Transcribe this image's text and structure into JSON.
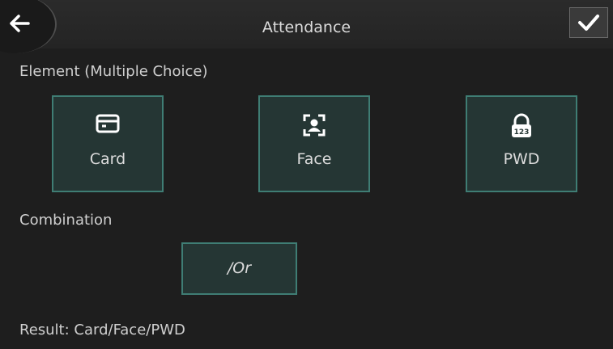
{
  "header": {
    "title": "Attendance",
    "back_icon": "arrow-left-icon",
    "confirm_icon": "checkmark-icon"
  },
  "element_section": {
    "label": "Element (Multiple Choice)",
    "options": [
      {
        "label": "Card",
        "icon": "card-icon",
        "selected": true
      },
      {
        "label": "Face",
        "icon": "face-icon",
        "selected": true
      },
      {
        "label": "PWD",
        "icon": "password-lock-icon",
        "selected": true
      }
    ]
  },
  "combination_section": {
    "label": "Combination",
    "value": "/Or"
  },
  "result": "Result: Card/Face/PWD",
  "colors": {
    "background": "#1e1e1e",
    "tile_fill": "#253634",
    "tile_border": "#3f7d74"
  }
}
